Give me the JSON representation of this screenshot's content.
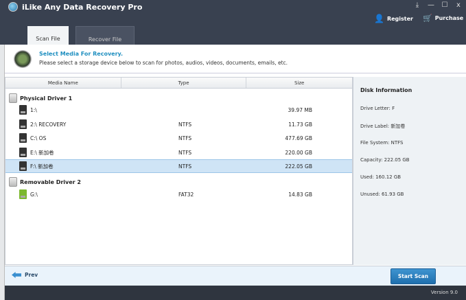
{
  "app": {
    "title": "iLike Any Data Recovery Pro"
  },
  "window_controls": {
    "download": "⤓",
    "minimize": "—",
    "maximize": "☐",
    "close": "x"
  },
  "top_actions": {
    "register": "Register",
    "purchase": "Purchase"
  },
  "tabs": [
    {
      "label": "Scan File",
      "active": true
    },
    {
      "label": "Recover File",
      "active": false
    }
  ],
  "header": {
    "title": "Select Media For Recovery.",
    "description": "Please select a storage device below to scan for photos, audios, videos, documents, emails, etc."
  },
  "table": {
    "columns": [
      "Media Name",
      "Type",
      "Size"
    ],
    "groups": [
      {
        "label": "Physical Driver 1",
        "items": [
          {
            "name": "1:\\",
            "type": "",
            "size": "39.97 MB"
          },
          {
            "name": "2:\\ RECOVERY",
            "type": "NTFS",
            "size": "11.73 GB"
          },
          {
            "name": "C:\\ OS",
            "type": "NTFS",
            "size": "477.69 GB"
          },
          {
            "name": "E:\\ 新加卷",
            "type": "NTFS",
            "size": "220.00 GB"
          },
          {
            "name": "F:\\ 新加卷",
            "type": "NTFS",
            "size": "222.05 GB",
            "selected": true
          }
        ]
      },
      {
        "label": "Removable Driver 2",
        "items": [
          {
            "name": "G:\\",
            "type": "FAT32",
            "size": "14.83 GB"
          }
        ]
      }
    ]
  },
  "disk_info": {
    "title": "Disk Information",
    "drive_letter": "Drive Letter: F",
    "drive_label": "Drive Label: 新加卷",
    "file_system": "File System: NTFS",
    "capacity": "Capacity: 222.05 GB",
    "used": "Used: 160.12 GB",
    "unused": "Unused: 61.93 GB"
  },
  "footer": {
    "prev": "Prev",
    "start_scan": "Start Scan",
    "version": "Version 9.0"
  }
}
